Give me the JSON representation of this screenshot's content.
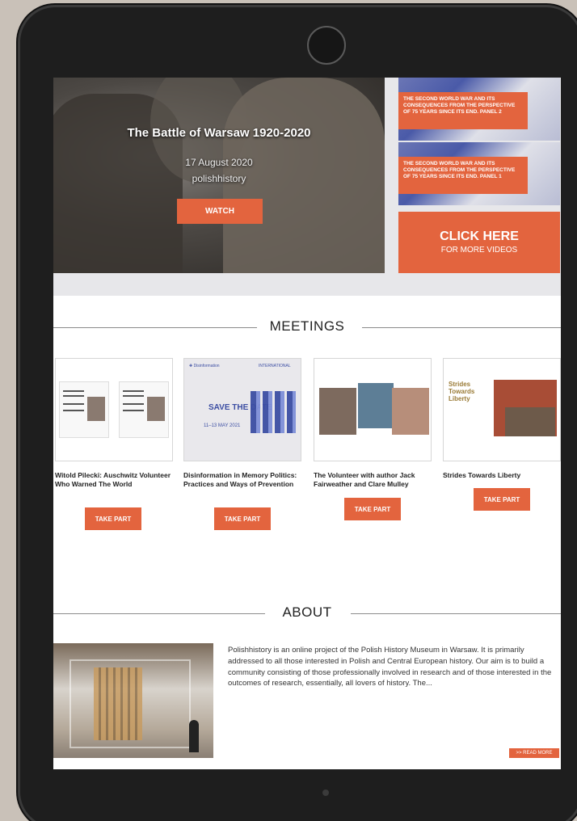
{
  "hero": {
    "title": "The Battle of Warsaw 1920-2020",
    "date": "17 August 2020",
    "channel": "polishhistory",
    "watch_label": "WATCH"
  },
  "panels": [
    {
      "label": "THE SECOND WORLD WAR AND ITS CONSEQUENCES FROM THE PERSPECTIVE OF 75 YEARS SINCE ITS END. PANEL 2"
    },
    {
      "label": "THE SECOND WORLD WAR AND ITS CONSEQUENCES FROM THE PERSPECTIVE OF 75 YEARS SINCE ITS END. PANEL 1"
    }
  ],
  "click_here": {
    "title": "CLICK HERE",
    "subtitle": "FOR MORE VIDEOS"
  },
  "meetings": {
    "heading": "MEETINGS",
    "items": [
      {
        "title": "Witold Pilecki: Auschwitz Volunteer Who Warned The World",
        "button": "TAKE PART"
      },
      {
        "title": "Disinformation in Memory Politics: Practices and Ways of Prevention",
        "button": "TAKE PART",
        "thumb_save": "SAVE THE DATE",
        "thumb_dates": "11–13 MAY 2021"
      },
      {
        "title": "The Volunteer with author Jack Fairweather and Clare Mulley",
        "button": "TAKE PART"
      },
      {
        "title": "Strides Towards Liberty",
        "button": "TAKE PART",
        "thumb_title": "Strides Towards Liberty"
      }
    ]
  },
  "about": {
    "heading": "ABOUT",
    "text": "Polishhistory is an online project of the Polish History Museum in Warsaw. It is primarily addressed to all those interested in Polish and Central European history. Our aim is to build a community consisting of those professionally involved in research and of those interested in the outcomes of research, essentially, all lovers of history. The...",
    "read_more": ">> READ MORE"
  },
  "colors": {
    "accent": "#e3643e",
    "bezel": "#1e1e1e"
  }
}
